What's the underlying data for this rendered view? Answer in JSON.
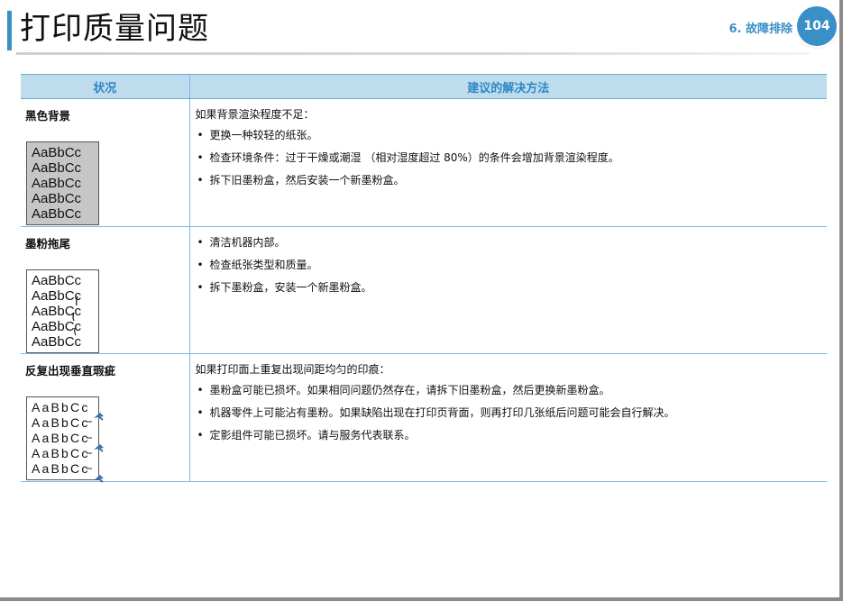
{
  "header": {
    "title": "打印质量问题",
    "chapter": "6. 故障排除",
    "page_number": "104"
  },
  "table": {
    "col_condition": "状况",
    "col_solution": "建议的解决方法",
    "rows": [
      {
        "condition": "黑色背景",
        "sample_lines": [
          "AaBbCc",
          "AaBbCc",
          "AaBbCc",
          "AaBbCc",
          "AaBbCc"
        ],
        "intro": "如果背景渲染程度不足：",
        "bullets": [
          "更换一种较轻的纸张。",
          "检查环境条件：过于干燥或潮湿 （相对湿度超过 80%）的条件会增加背景渲染程度。",
          "拆下旧墨粉盒，然后安装一个新墨粉盒。"
        ]
      },
      {
        "condition": "墨粉拖尾",
        "sample_lines": [
          "AaBbCc",
          "AaBbCc",
          "AaBbCc",
          "AaBbCc",
          "AaBbCc"
        ],
        "intro": "",
        "bullets": [
          "清洁机器内部。",
          "检查纸张类型和质量。",
          "拆下墨粉盒，安装一个新墨粉盒。"
        ]
      },
      {
        "condition": "反复出现垂直瑕疵",
        "sample_lines": [
          "AaBbCc",
          "AaBbCc",
          "AaBbCc",
          "AaBbCc",
          "AaBbCc"
        ],
        "intro": "如果打印面上重复出现间距均匀的印痕：",
        "bullets": [
          "墨粉盒可能已损坏。如果相同问题仍然存在，请拆下旧墨粉盒，然后更换新墨粉盒。",
          "机器零件上可能沾有墨粉。如果缺陷出现在打印页背面，则再打印几张纸后问题可能会自行解决。",
          "定影组件可能已损坏。请与服务代表联系。"
        ]
      }
    ]
  },
  "colors": {
    "accent": "#3a8fc7",
    "header_fill": "#bfdcef",
    "rule": "#7fb5db"
  }
}
